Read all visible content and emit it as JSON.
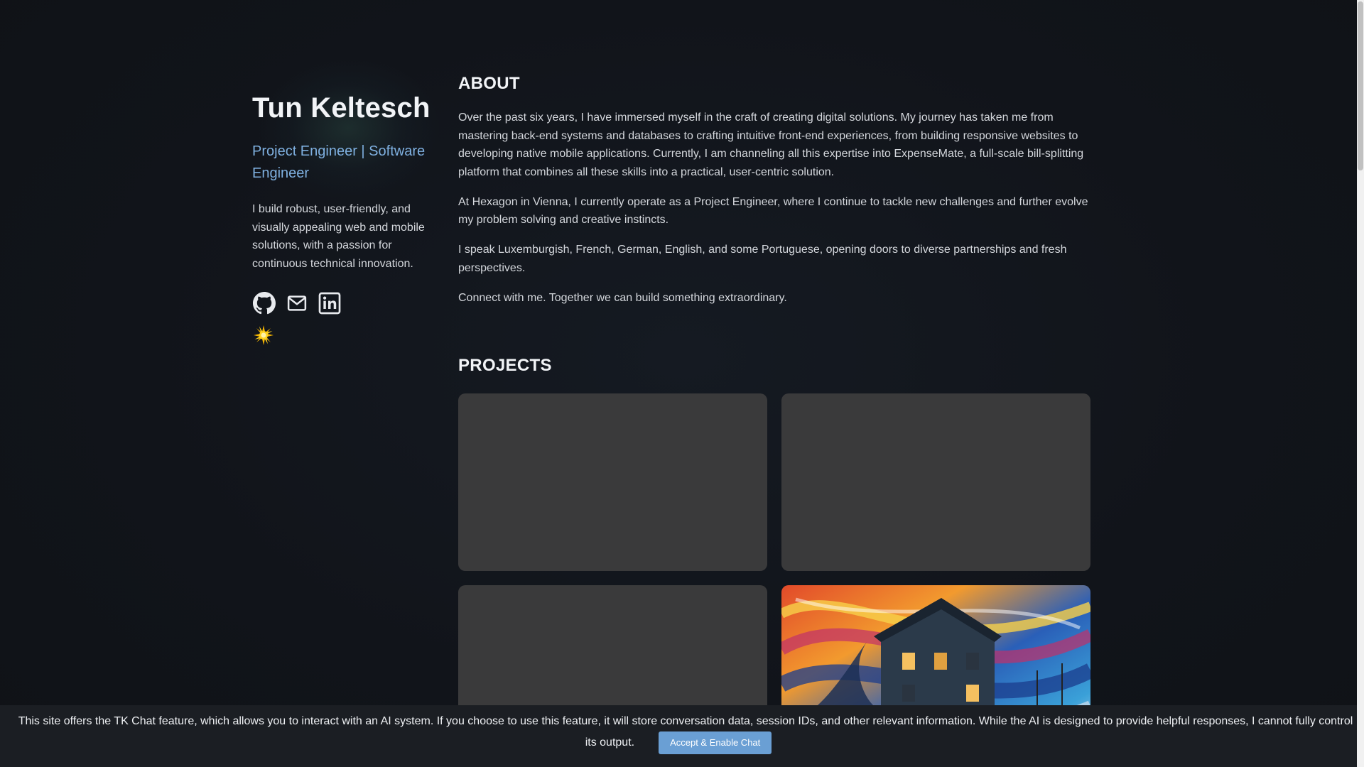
{
  "profile": {
    "name": "Tun Keltesch",
    "role": "Project Engineer | Software Engineer",
    "intro": "I build robust, user-friendly, and visually appealing web and mobile solutions, with a passion for continuous technical innovation.",
    "socials": [
      {
        "icon": "github-icon"
      },
      {
        "icon": "mail-icon"
      },
      {
        "icon": "linkedin-icon"
      }
    ],
    "theme_toggle_icon": "sun-icon"
  },
  "about": {
    "title": "ABOUT",
    "paragraphs": [
      "Over the past six years, I have immersed myself in the craft of creating digital solutions. My journey has taken me from mastering back-end systems and databases to crafting intuitive front-end experiences, from building responsive websites to developing native mobile applications. Currently, I am channeling all this expertise into ExpenseMate, a full-scale bill-splitting platform that combines all these skills into a practical, user-centric solution.",
      "At Hexagon in Vienna, I currently operate as a Project Engineer, where I continue to tackle new challenges and further evolve my problem solving and creative instincts.",
      "I speak Luxemburgish, French, German, English, and some Portuguese, opening doors to diverse partnerships and fresh perspectives.",
      "Connect with me. Together we can build something extraordinary."
    ]
  },
  "projects": {
    "title": "PROJECTS"
  },
  "consent": {
    "text": "This site offers the TK Chat feature, which allows you to interact with an AI system. If you choose to use this feature, it will store conversation data, session IDs, and other relevant information. While the AI is designed to provide helpful responses, I cannot fully control its output.",
    "button_label": "Accept & Enable Chat"
  },
  "colors": {
    "background": "#111418",
    "accent": "#7fb0e0",
    "button": "#6a9fd4",
    "card_placeholder": "#3a3a3b"
  }
}
